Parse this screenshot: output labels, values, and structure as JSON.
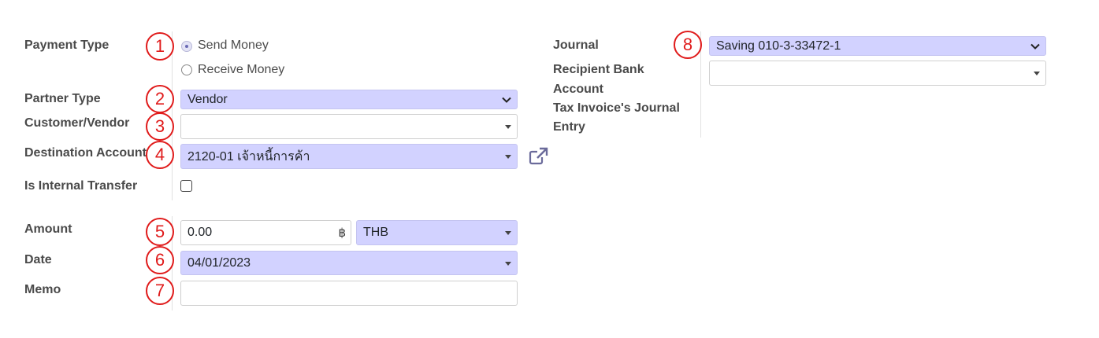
{
  "left": {
    "payment_type_label": "Payment Type",
    "payment_type_options": [
      "Send Money",
      "Receive Money"
    ],
    "payment_type_selected": "Send Money",
    "partner_type_label": "Partner Type",
    "partner_type_value": "Vendor",
    "customer_vendor_label": "Customer/Vendor",
    "customer_vendor_value": "",
    "destination_account_label": "Destination Account",
    "destination_account_value": "2120-01 เจ้าหนี้การค้า",
    "internal_transfer_label": "Is Internal Transfer",
    "internal_transfer_checked": false,
    "amount_label": "Amount",
    "amount_value": "0.00",
    "currency_symbol": "฿",
    "currency_value": "THB",
    "date_label": "Date",
    "date_value": "04/01/2023",
    "memo_label": "Memo",
    "memo_value": ""
  },
  "right": {
    "journal_label": "Journal",
    "journal_value": "Saving 010-3-33472-1",
    "recipient_bank_label_1": "Recipient Bank",
    "recipient_bank_label_2": "Account",
    "recipient_bank_value": "",
    "tax_invoice_label_1": "Tax Invoice's Journal",
    "tax_invoice_label_2": "Entry"
  },
  "markers": [
    "1",
    "2",
    "3",
    "4",
    "5",
    "6",
    "7",
    "8"
  ],
  "icons": {
    "external_link": "external-link-icon"
  },
  "colors": {
    "required_bg": "#d2d2ff",
    "marker": "#e01b1b",
    "accent": "#6b6bb4"
  }
}
